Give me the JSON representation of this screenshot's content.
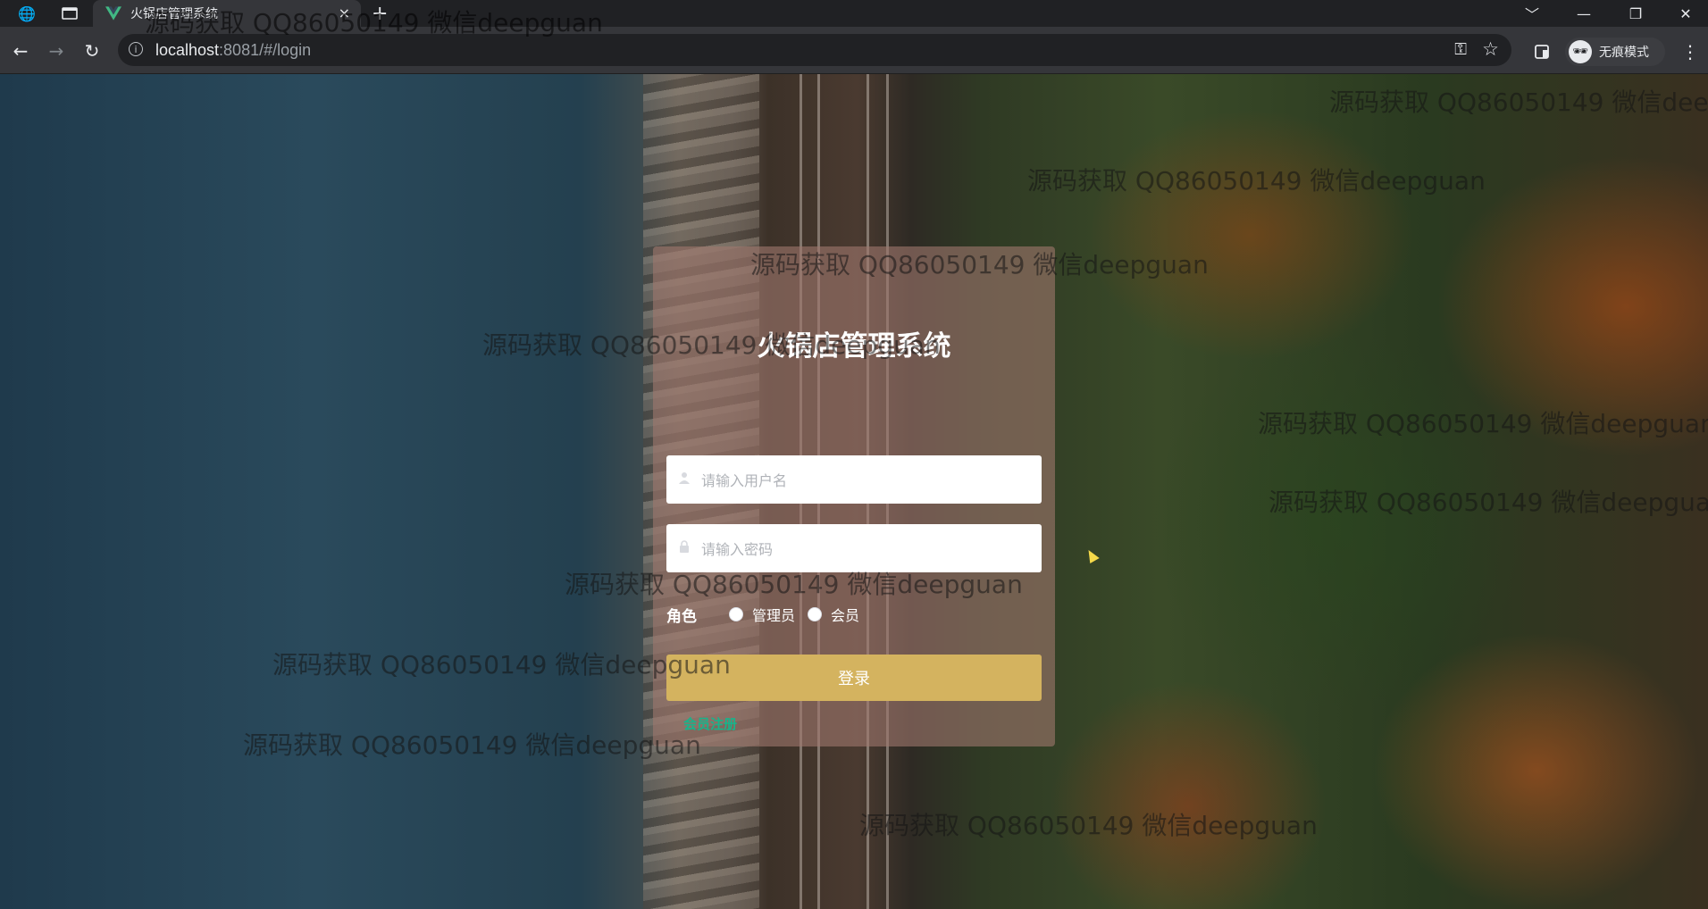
{
  "browser": {
    "tab_title": "火锅店管理系统",
    "tab_close": "×",
    "new_tab": "+",
    "url_host": "localhost",
    "url_rest": ":8081/#/login",
    "profile_label": "无痕模式",
    "window_controls": [
      "﹀",
      "—",
      "❐",
      "✕"
    ]
  },
  "login": {
    "title": "火锅店管理系统",
    "username_placeholder": "请输入用户名",
    "password_placeholder": "请输入密码",
    "role_label": "角色",
    "role_options": [
      "管理员",
      "会员"
    ],
    "selected_role": "",
    "login_button": "登录",
    "register_link": "会员注册"
  },
  "watermarks": [
    "源码获取 QQ86050149 微信deepguan",
    "源码获取 QQ86050149 微信deepguan",
    "源码获取 QQ86050149 微信deepguan",
    "源码获取 QQ86050149 微信deepguan",
    "源码获取 QQ86050149 微信deepguan",
    "源码获取 QQ86050149 微信deepguan",
    "源码获取 QQ86050149 微信deepguan",
    "源码获取 QQ86050149 微信deepguan",
    "源码获取 QQ86050149 微信deepguan",
    "源码获取 QQ86050149 微信deepguan",
    "源码获取 QQ86050149 微信deepguan"
  ],
  "icons": {
    "browser_app": "globe-icon",
    "tab_strip": "tab-search-icon",
    "tab_favicon": "vue-logo-icon",
    "user": "user-icon",
    "lock": "lock-icon"
  },
  "colors": {
    "button": "#d4b35f",
    "register_link": "#19b38a",
    "card": "rgba(160,120,110,0.6)"
  }
}
